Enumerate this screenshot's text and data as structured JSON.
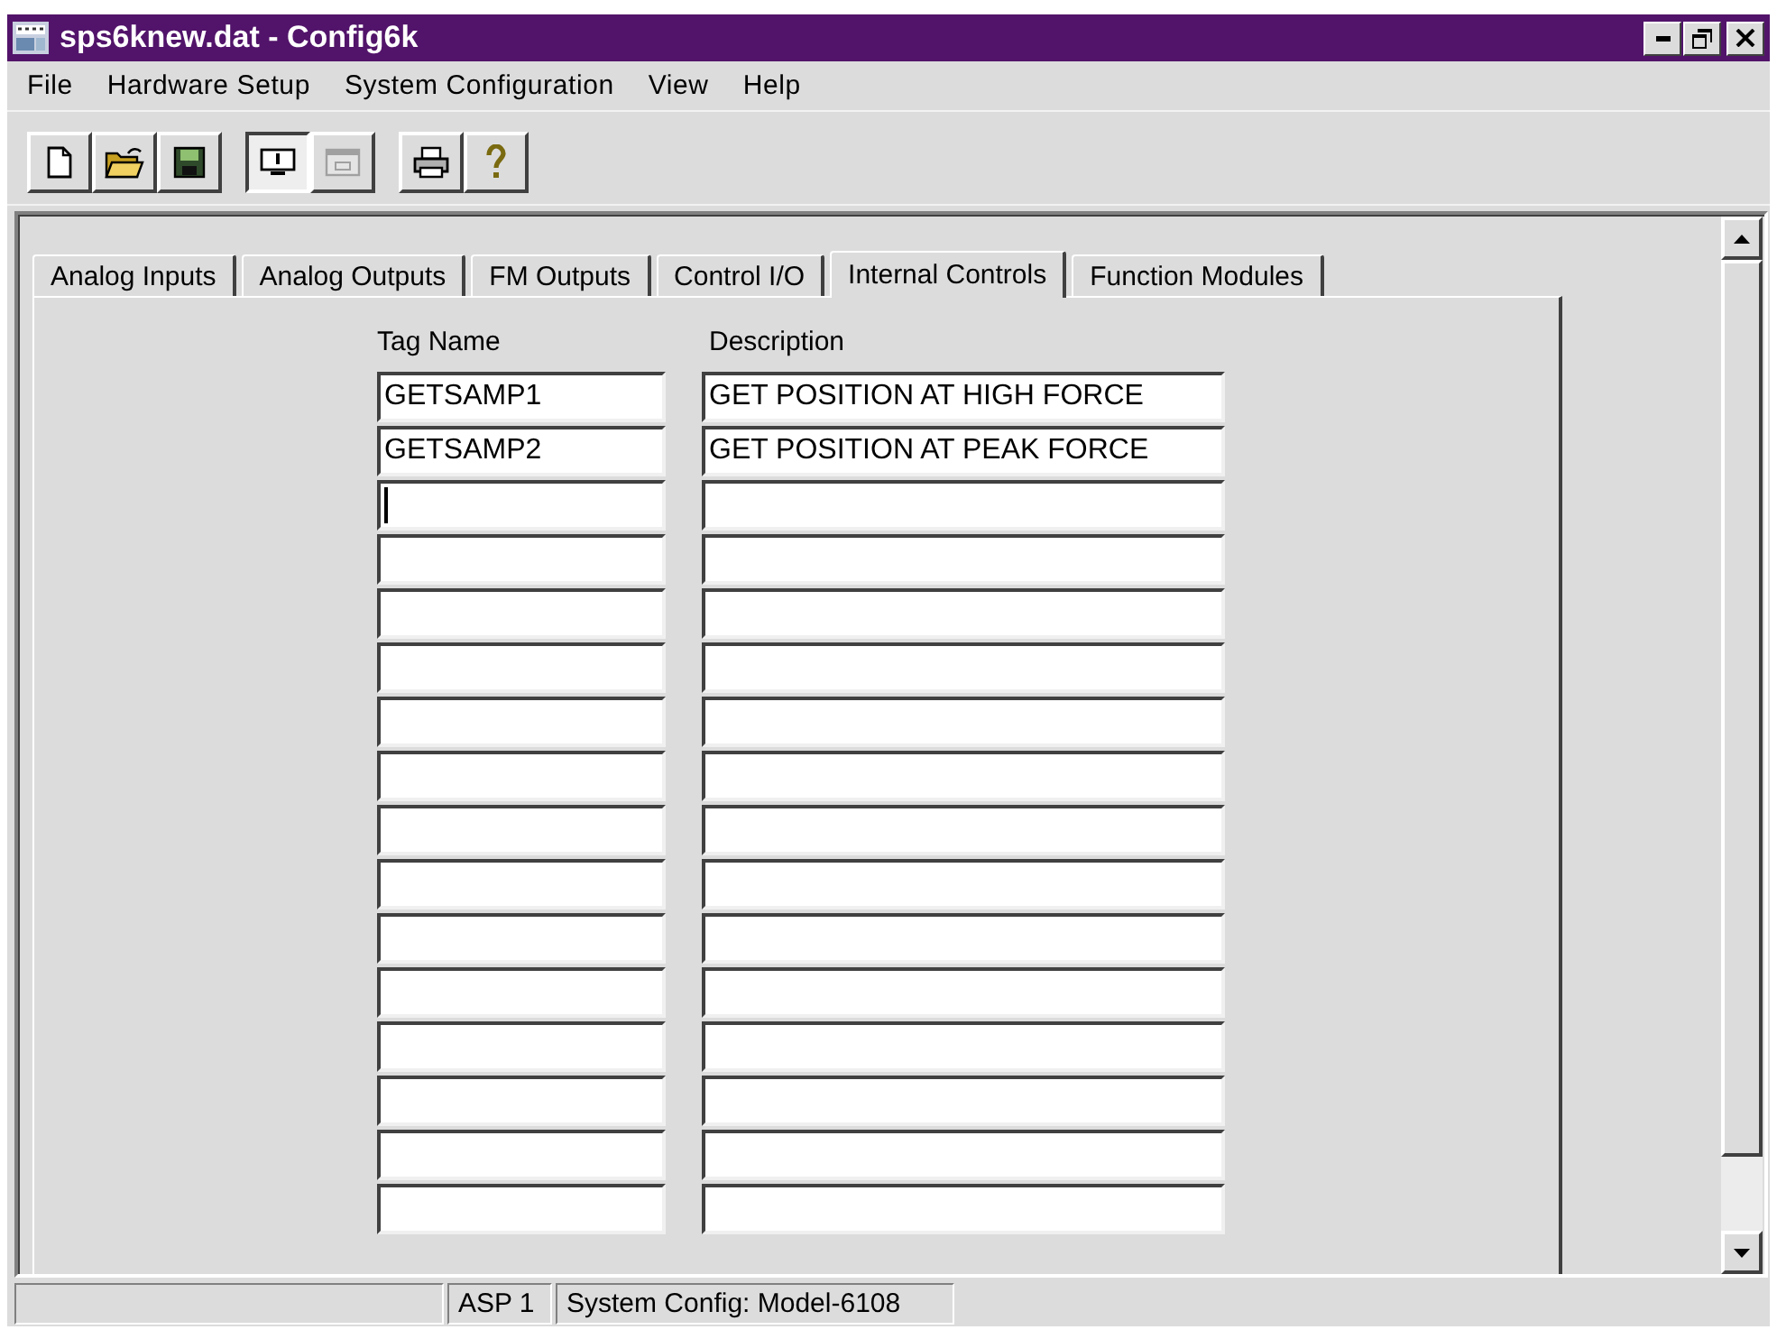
{
  "window": {
    "title": "sps6knew.dat - Config6k"
  },
  "menu": [
    {
      "label": "File"
    },
    {
      "label": "Hardware Setup"
    },
    {
      "label": "System Configuration"
    },
    {
      "label": "View"
    },
    {
      "label": "Help"
    }
  ],
  "toolbar_groups": [
    {
      "buttons": [
        {
          "kind": "new",
          "pressed": false,
          "disabled": false
        },
        {
          "kind": "open",
          "pressed": false,
          "disabled": false
        },
        {
          "kind": "save",
          "pressed": false,
          "disabled": false
        }
      ]
    },
    {
      "buttons": [
        {
          "kind": "monitor",
          "pressed": true,
          "disabled": false
        },
        {
          "kind": "window",
          "pressed": false,
          "disabled": true
        }
      ]
    },
    {
      "buttons": [
        {
          "kind": "print",
          "pressed": false,
          "disabled": false
        },
        {
          "kind": "help",
          "pressed": false,
          "disabled": false
        }
      ]
    }
  ],
  "tabs": [
    {
      "label": "Analog Inputs",
      "selected": false
    },
    {
      "label": "Analog Outputs",
      "selected": false
    },
    {
      "label": "FM Outputs",
      "selected": false
    },
    {
      "label": "Control I/O",
      "selected": false
    },
    {
      "label": "Internal Controls",
      "selected": true
    },
    {
      "label": "Function Modules",
      "selected": false
    }
  ],
  "table": {
    "columns": [
      "Tag Name",
      "Description"
    ],
    "rows": [
      {
        "tag_name": "GETSAMP1",
        "description": "GET POSITION AT HIGH FORCE",
        "focused": false
      },
      {
        "tag_name": "GETSAMP2",
        "description": "GET POSITION AT PEAK FORCE",
        "focused": false
      },
      {
        "focused": true
      },
      {
        "focused": false
      },
      {
        "focused": false
      },
      {
        "focused": false
      },
      {
        "focused": false
      },
      {
        "focused": false
      },
      {
        "focused": false
      },
      {
        "focused": false
      },
      {
        "focused": false
      },
      {
        "focused": false
      },
      {
        "focused": false
      },
      {
        "focused": false
      },
      {
        "focused": false
      },
      {
        "focused": false
      }
    ]
  },
  "status_bar": {
    "panels": [
      "ASP 1",
      "System Config: Model-6108"
    ]
  }
}
